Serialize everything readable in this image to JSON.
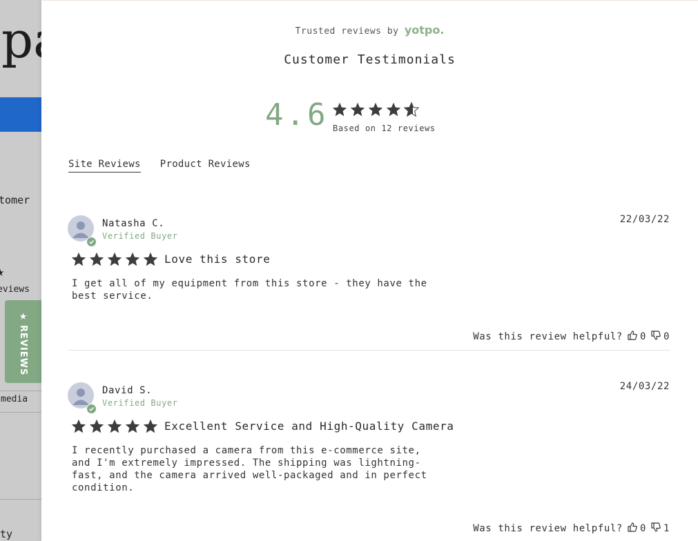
{
  "background": {
    "title_fragment": "pa",
    "customer_fragment": "tomer",
    "reviews_fragment": "eviews",
    "media_fragment": "media",
    "bottom_fragment": "ty",
    "reviews_tab_label": "REVIEWS"
  },
  "modal": {
    "trusted_prefix": "Trusted reviews by",
    "trusted_brand": "yotpo.",
    "title": "Customer Testimonials",
    "score": "4.6",
    "score_rating": 4.6,
    "based_on": "Based on 12 reviews",
    "tabs": [
      {
        "label": "Site Reviews",
        "active": true
      },
      {
        "label": "Product Reviews",
        "active": false
      }
    ]
  },
  "reviews": [
    {
      "name": "Natasha C.",
      "verified": "Verified Buyer",
      "date": "22/03/22",
      "rating": 5,
      "title": "Love this store",
      "body_lines": [
        "I get all of my equipment from this store - they have the",
        "best service."
      ],
      "helpful_prompt": "Was this review helpful?",
      "up_votes": "0",
      "down_votes": "0"
    },
    {
      "name": "David S.",
      "verified": "Verified Buyer",
      "date": "24/03/22",
      "rating": 5,
      "title": "Excellent Service and High-Quality Camera",
      "body_lines": [
        "I recently purchased a camera from this e-commerce site,",
        "and I'm extremely impressed. The shipping was lightning-",
        "fast, and the camera arrived well-packaged and in perfect",
        "condition."
      ],
      "helpful_prompt": "Was this review helpful?",
      "up_votes": "0",
      "down_votes": "1"
    }
  ],
  "colors": {
    "accent": "#82a884",
    "star": "#3d3d3d",
    "background_blue": "#1f67c9"
  },
  "icons": {
    "star": "star-icon",
    "thumb_up": "thumbs-up-icon",
    "thumb_down": "thumbs-down-icon",
    "avatar": "user-avatar-icon",
    "verified": "check-icon"
  }
}
